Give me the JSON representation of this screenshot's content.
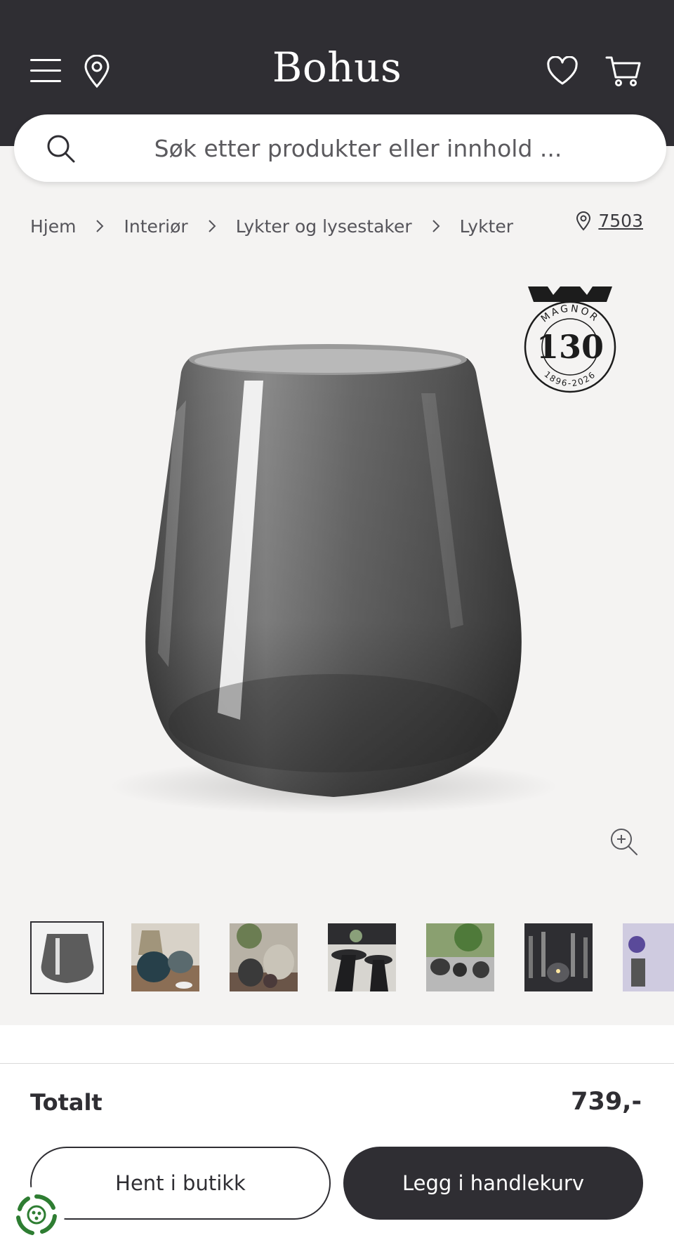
{
  "header": {
    "logo": "Bohus",
    "menu_icon": "hamburger-menu-icon",
    "location_icon": "map-pin-icon",
    "wishlist_icon": "heart-icon",
    "cart_icon": "shopping-cart-icon",
    "colors": {
      "bar": "#2f2e33",
      "logo": "#ffffff"
    }
  },
  "search": {
    "placeholder": "Søk etter produkter eller innhold ...",
    "icon": "search-icon"
  },
  "breadcrumb": {
    "items": [
      "Hjem",
      "Interiør",
      "Lykter og lysestaker",
      "Lykter"
    ],
    "store_code": "7503"
  },
  "badge": {
    "brand": "MAGNOR",
    "number": "130",
    "years": "1896-2026"
  },
  "gallery": {
    "zoom_icon": "zoom-in-icon",
    "thumbnails": [
      "thumbnail-1",
      "thumbnail-2",
      "thumbnail-3",
      "thumbnail-4",
      "thumbnail-5",
      "thumbnail-6",
      "thumbnail-7"
    ],
    "active_index": 0
  },
  "footer": {
    "total_label": "Totalt",
    "total_value": "739,-",
    "pickup_button": "Hent i butikk",
    "add_to_cart_button": "Legg i handlekurv",
    "eco_icon": "recycle-leaf-icon",
    "colors": {
      "primary": "#2f2e33",
      "eco": "#2e7d32"
    }
  }
}
